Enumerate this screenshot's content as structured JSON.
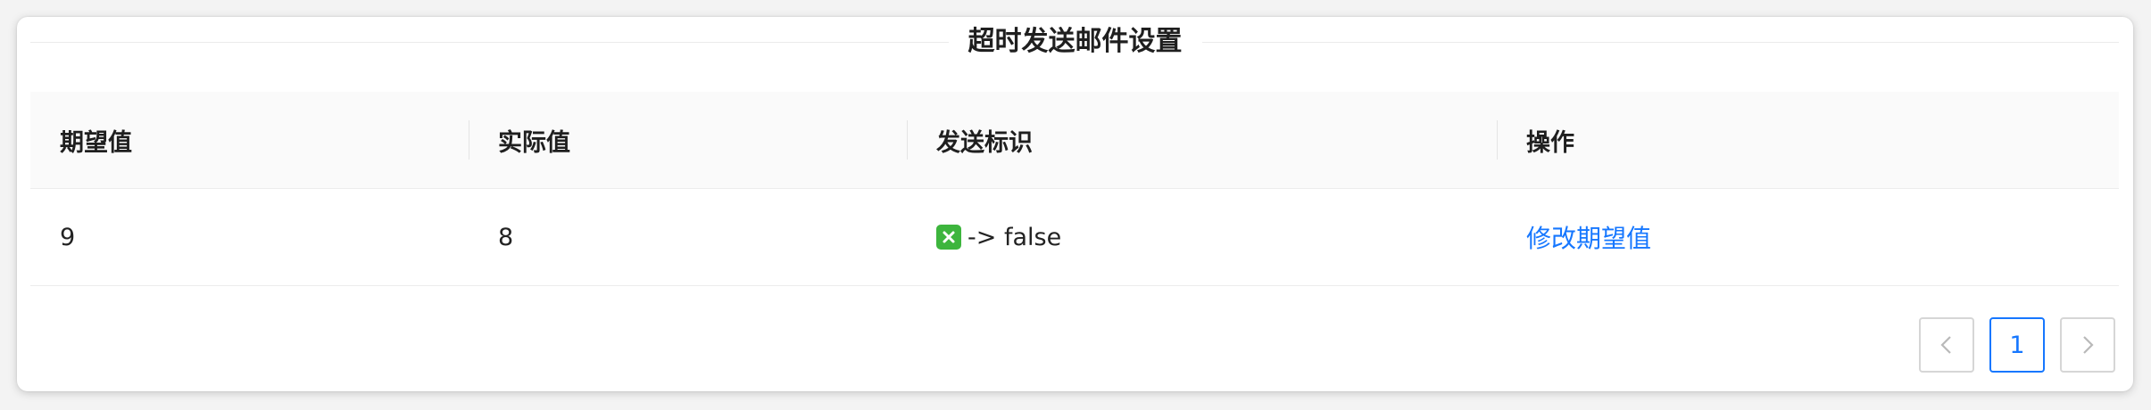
{
  "section": {
    "title": "超时发送邮件设置"
  },
  "table": {
    "headers": [
      "期望值",
      "实际值",
      "发送标识",
      "操作"
    ],
    "rows": [
      {
        "expected": "9",
        "actual": "8",
        "flag_icon": "cross-mark-icon",
        "flag_text": "-> false",
        "action": "修改期望值"
      }
    ]
  },
  "pagination": {
    "prev_icon": "chevron-left-icon",
    "current_page": "1",
    "next_icon": "chevron-right-icon"
  },
  "colors": {
    "link": "#1677ff",
    "icon_bg": "#3db53d",
    "header_bg": "#fafafa"
  }
}
